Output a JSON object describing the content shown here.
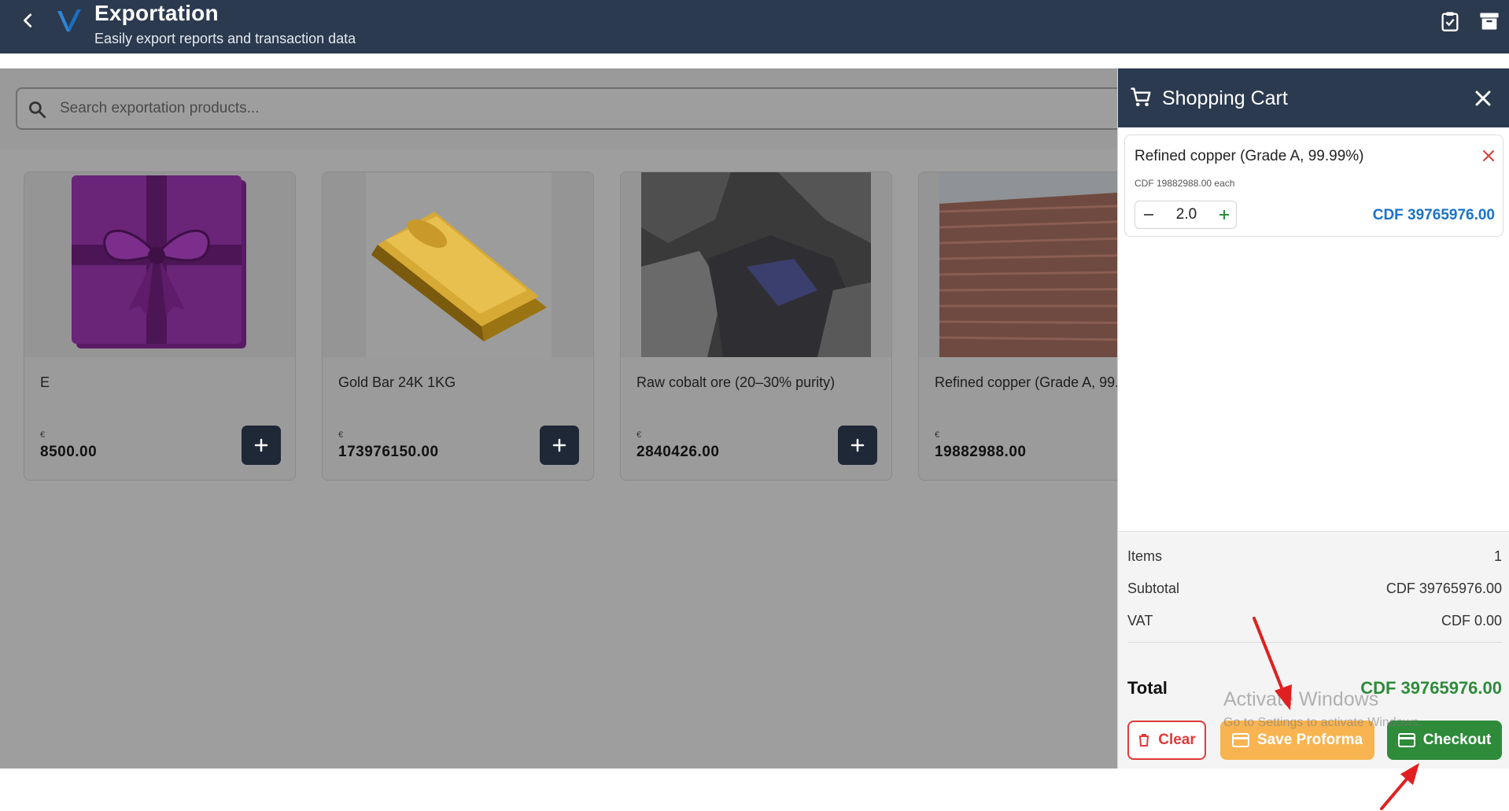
{
  "appbar": {
    "title": "Exportation",
    "subtitle": "Easily export reports and transaction data",
    "icons": [
      "back-arrow-icon",
      "brand-logo",
      "clipboard-check-icon",
      "archive-icon"
    ]
  },
  "search": {
    "placeholder": "Search exportation products..."
  },
  "products": [
    {
      "name": "E",
      "currency": "€",
      "price": "8500.00",
      "image": "purple-gift-box"
    },
    {
      "name": "Gold Bar 24K 1KG",
      "currency": "€",
      "price": "173976150.00",
      "image": "gold-bar"
    },
    {
      "name": "Raw cobalt ore (20–30% purity)",
      "currency": "€",
      "price": "2840426.00",
      "image": "cobalt-ore"
    },
    {
      "name": "Refined copper (Grade A, 99.99%)",
      "currency": "€",
      "price": "19882988.00",
      "image": "copper-sheets"
    }
  ],
  "cart": {
    "title": "Shopping Cart",
    "items": [
      {
        "name": "Refined copper (Grade A, 99.99%)",
        "unit_price": "CDF 19882988.00 each",
        "quantity": "2.0",
        "line_total": "CDF 39765976.00"
      }
    ],
    "summary": {
      "items_label": "Items",
      "items_value": "1",
      "subtotal_label": "Subtotal",
      "subtotal_value": "CDF 39765976.00",
      "vat_label": "VAT",
      "vat_value": "CDF 0.00",
      "total_label": "Total",
      "total_value": "CDF 39765976.00"
    },
    "buttons": {
      "clear": "Clear",
      "save_proforma": "Save Proforma",
      "checkout": "Checkout"
    }
  },
  "watermark": {
    "line1": "Activate Windows",
    "line2": "Go to Settings to activate Windows."
  },
  "colors": {
    "header": "#2b3a4f",
    "total_green": "#2e8b3a",
    "line_total_blue": "#1a73c9",
    "proforma_orange": "#f7b451",
    "clear_red": "#e03a3a",
    "annotation_red": "#e02020"
  }
}
